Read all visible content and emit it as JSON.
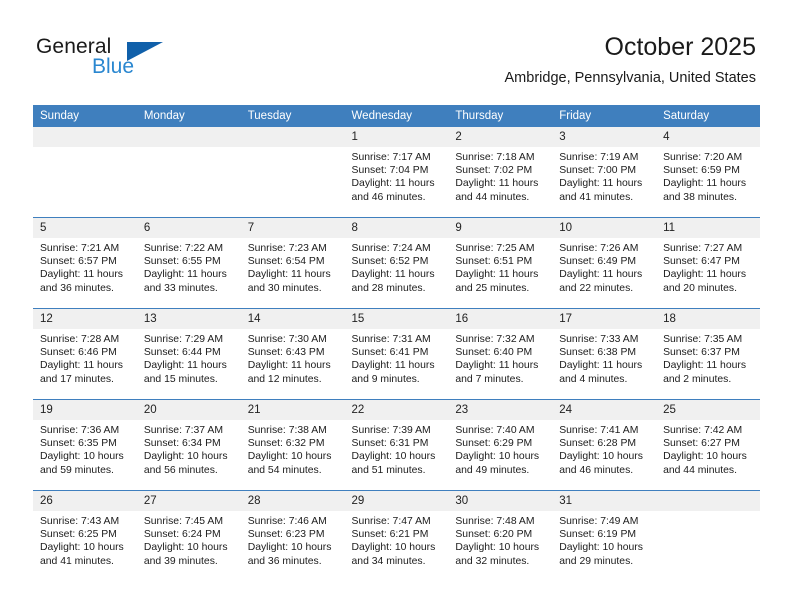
{
  "brand": {
    "name_part1": "General",
    "name_part2": "Blue",
    "logo_icon": "triangle-logo-icon",
    "accent_color": "#1060aa",
    "secondary_color": "#2a87d0"
  },
  "header": {
    "title": "October 2025",
    "subtitle": "Ambridge, Pennsylvania, United States"
  },
  "theme": {
    "header_row_bg": "#3f7fbe",
    "daynum_bg": "#f0f0f0",
    "grid_line": "#3f7fbe",
    "text": "#1c1c1c"
  },
  "calendar": {
    "weekday_headers": [
      "Sunday",
      "Monday",
      "Tuesday",
      "Wednesday",
      "Thursday",
      "Friday",
      "Saturday"
    ],
    "labels": {
      "sunrise": "Sunrise:",
      "sunset": "Sunset:",
      "daylight": "Daylight:"
    },
    "weeks": [
      [
        {
          "day": "",
          "empty": true
        },
        {
          "day": "",
          "empty": true
        },
        {
          "day": "",
          "empty": true
        },
        {
          "day": "1",
          "sunrise": "Sunrise: 7:17 AM",
          "sunset": "Sunset: 7:04 PM",
          "daylight": "Daylight: 11 hours and 46 minutes."
        },
        {
          "day": "2",
          "sunrise": "Sunrise: 7:18 AM",
          "sunset": "Sunset: 7:02 PM",
          "daylight": "Daylight: 11 hours and 44 minutes."
        },
        {
          "day": "3",
          "sunrise": "Sunrise: 7:19 AM",
          "sunset": "Sunset: 7:00 PM",
          "daylight": "Daylight: 11 hours and 41 minutes."
        },
        {
          "day": "4",
          "sunrise": "Sunrise: 7:20 AM",
          "sunset": "Sunset: 6:59 PM",
          "daylight": "Daylight: 11 hours and 38 minutes."
        }
      ],
      [
        {
          "day": "5",
          "sunrise": "Sunrise: 7:21 AM",
          "sunset": "Sunset: 6:57 PM",
          "daylight": "Daylight: 11 hours and 36 minutes."
        },
        {
          "day": "6",
          "sunrise": "Sunrise: 7:22 AM",
          "sunset": "Sunset: 6:55 PM",
          "daylight": "Daylight: 11 hours and 33 minutes."
        },
        {
          "day": "7",
          "sunrise": "Sunrise: 7:23 AM",
          "sunset": "Sunset: 6:54 PM",
          "daylight": "Daylight: 11 hours and 30 minutes."
        },
        {
          "day": "8",
          "sunrise": "Sunrise: 7:24 AM",
          "sunset": "Sunset: 6:52 PM",
          "daylight": "Daylight: 11 hours and 28 minutes."
        },
        {
          "day": "9",
          "sunrise": "Sunrise: 7:25 AM",
          "sunset": "Sunset: 6:51 PM",
          "daylight": "Daylight: 11 hours and 25 minutes."
        },
        {
          "day": "10",
          "sunrise": "Sunrise: 7:26 AM",
          "sunset": "Sunset: 6:49 PM",
          "daylight": "Daylight: 11 hours and 22 minutes."
        },
        {
          "day": "11",
          "sunrise": "Sunrise: 7:27 AM",
          "sunset": "Sunset: 6:47 PM",
          "daylight": "Daylight: 11 hours and 20 minutes."
        }
      ],
      [
        {
          "day": "12",
          "sunrise": "Sunrise: 7:28 AM",
          "sunset": "Sunset: 6:46 PM",
          "daylight": "Daylight: 11 hours and 17 minutes."
        },
        {
          "day": "13",
          "sunrise": "Sunrise: 7:29 AM",
          "sunset": "Sunset: 6:44 PM",
          "daylight": "Daylight: 11 hours and 15 minutes."
        },
        {
          "day": "14",
          "sunrise": "Sunrise: 7:30 AM",
          "sunset": "Sunset: 6:43 PM",
          "daylight": "Daylight: 11 hours and 12 minutes."
        },
        {
          "day": "15",
          "sunrise": "Sunrise: 7:31 AM",
          "sunset": "Sunset: 6:41 PM",
          "daylight": "Daylight: 11 hours and 9 minutes."
        },
        {
          "day": "16",
          "sunrise": "Sunrise: 7:32 AM",
          "sunset": "Sunset: 6:40 PM",
          "daylight": "Daylight: 11 hours and 7 minutes."
        },
        {
          "day": "17",
          "sunrise": "Sunrise: 7:33 AM",
          "sunset": "Sunset: 6:38 PM",
          "daylight": "Daylight: 11 hours and 4 minutes."
        },
        {
          "day": "18",
          "sunrise": "Sunrise: 7:35 AM",
          "sunset": "Sunset: 6:37 PM",
          "daylight": "Daylight: 11 hours and 2 minutes."
        }
      ],
      [
        {
          "day": "19",
          "sunrise": "Sunrise: 7:36 AM",
          "sunset": "Sunset: 6:35 PM",
          "daylight": "Daylight: 10 hours and 59 minutes."
        },
        {
          "day": "20",
          "sunrise": "Sunrise: 7:37 AM",
          "sunset": "Sunset: 6:34 PM",
          "daylight": "Daylight: 10 hours and 56 minutes."
        },
        {
          "day": "21",
          "sunrise": "Sunrise: 7:38 AM",
          "sunset": "Sunset: 6:32 PM",
          "daylight": "Daylight: 10 hours and 54 minutes."
        },
        {
          "day": "22",
          "sunrise": "Sunrise: 7:39 AM",
          "sunset": "Sunset: 6:31 PM",
          "daylight": "Daylight: 10 hours and 51 minutes."
        },
        {
          "day": "23",
          "sunrise": "Sunrise: 7:40 AM",
          "sunset": "Sunset: 6:29 PM",
          "daylight": "Daylight: 10 hours and 49 minutes."
        },
        {
          "day": "24",
          "sunrise": "Sunrise: 7:41 AM",
          "sunset": "Sunset: 6:28 PM",
          "daylight": "Daylight: 10 hours and 46 minutes."
        },
        {
          "day": "25",
          "sunrise": "Sunrise: 7:42 AM",
          "sunset": "Sunset: 6:27 PM",
          "daylight": "Daylight: 10 hours and 44 minutes."
        }
      ],
      [
        {
          "day": "26",
          "sunrise": "Sunrise: 7:43 AM",
          "sunset": "Sunset: 6:25 PM",
          "daylight": "Daylight: 10 hours and 41 minutes."
        },
        {
          "day": "27",
          "sunrise": "Sunrise: 7:45 AM",
          "sunset": "Sunset: 6:24 PM",
          "daylight": "Daylight: 10 hours and 39 minutes."
        },
        {
          "day": "28",
          "sunrise": "Sunrise: 7:46 AM",
          "sunset": "Sunset: 6:23 PM",
          "daylight": "Daylight: 10 hours and 36 minutes."
        },
        {
          "day": "29",
          "sunrise": "Sunrise: 7:47 AM",
          "sunset": "Sunset: 6:21 PM",
          "daylight": "Daylight: 10 hours and 34 minutes."
        },
        {
          "day": "30",
          "sunrise": "Sunrise: 7:48 AM",
          "sunset": "Sunset: 6:20 PM",
          "daylight": "Daylight: 10 hours and 32 minutes."
        },
        {
          "day": "31",
          "sunrise": "Sunrise: 7:49 AM",
          "sunset": "Sunset: 6:19 PM",
          "daylight": "Daylight: 10 hours and 29 minutes."
        },
        {
          "day": "",
          "empty": true
        }
      ]
    ]
  }
}
